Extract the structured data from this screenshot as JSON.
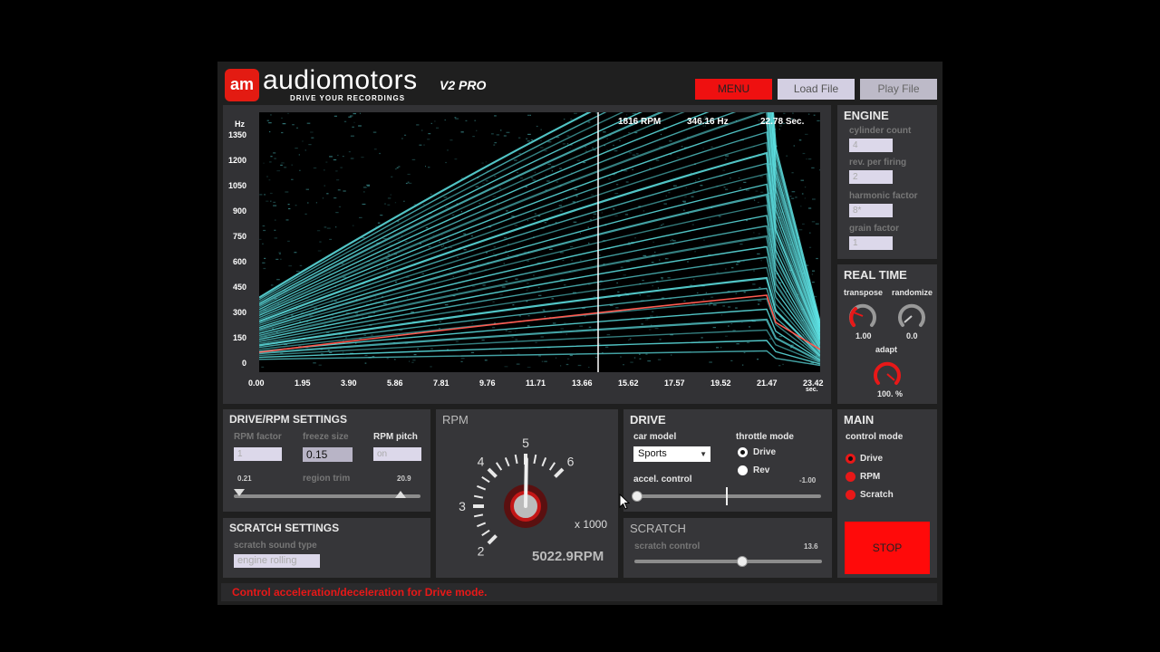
{
  "header": {
    "logo_badge": "am",
    "brand": "audiomotors",
    "version": "V2 PRO",
    "tagline": "DRIVE YOUR RECORDINGS",
    "menu_label": "MENU",
    "load_label": "Load File",
    "play_label": "Play File"
  },
  "spectrogram": {
    "y_unit": "Hz",
    "y_ticks": [
      "1350",
      "1200",
      "1050",
      "900",
      "750",
      "600",
      "450",
      "300",
      "150",
      "0"
    ],
    "x_ticks": [
      "0.00",
      "1.95",
      "3.90",
      "5.86",
      "7.81",
      "9.76",
      "11.71",
      "13.66",
      "15.62",
      "17.57",
      "19.52",
      "21.47",
      "23.42"
    ],
    "x_unit": "sec.",
    "readout_rpm": "1816",
    "readout_rpm_unit": "RPM",
    "readout_hz": "346.16",
    "readout_hz_unit": "Hz",
    "readout_sec": "22.78",
    "readout_sec_unit": "Sec."
  },
  "engine": {
    "title": "ENGINE",
    "cylinder_label": "cylinder count",
    "cylinder_value": "4",
    "rev_label": "rev. per firing",
    "rev_value": "2",
    "harmonic_label": "harmonic factor",
    "harmonic_value": "8*",
    "grain_label": "grain factor",
    "grain_value": "1"
  },
  "realtime": {
    "title": "REAL TIME",
    "transpose_label": "transpose",
    "transpose_value": "1.00",
    "randomize_label": "randomize",
    "randomize_value": "0.0",
    "adapt_label": "adapt",
    "adapt_value": "100. %"
  },
  "drive_rpm": {
    "title": "DRIVE/RPM SETTINGS",
    "rpm_factor_label": "RPM factor",
    "rpm_factor_value": "1",
    "freeze_label": "freeze size",
    "freeze_value": "0.15",
    "pitch_label": "RPM pitch",
    "pitch_value": "on",
    "trim_label": "region trim",
    "trim_min": "0.21",
    "trim_max": "20.9"
  },
  "rpm": {
    "title": "RPM",
    "dial_numbers": [
      "2",
      "3",
      "4",
      "5",
      "6"
    ],
    "multiplier": "x 1000",
    "value": "5022.9",
    "unit": "RPM",
    "needle_value": 5.02
  },
  "drive": {
    "title": "DRIVE",
    "car_model_label": "car model",
    "car_model_value": "Sports",
    "throttle_label": "throttle mode",
    "throttle_options": [
      "Drive",
      "Rev"
    ],
    "accel_label": "accel. control",
    "accel_value": "-1.00"
  },
  "main": {
    "title": "MAIN",
    "control_label": "control mode",
    "modes": [
      "Drive",
      "RPM",
      "Scratch"
    ],
    "stop_label": "STOP"
  },
  "scratch_settings": {
    "title": "SCRATCH SETTINGS",
    "type_label": "scratch sound type",
    "type_value": "engine rolling"
  },
  "scratch": {
    "title": "SCRATCH",
    "control_label": "scratch control",
    "control_value": "13.6"
  },
  "status": {
    "message": "Control acceleration/deceleration for Drive mode."
  },
  "colors": {
    "accent_red": "#e81818",
    "spectrum": "#5fe6e8"
  }
}
